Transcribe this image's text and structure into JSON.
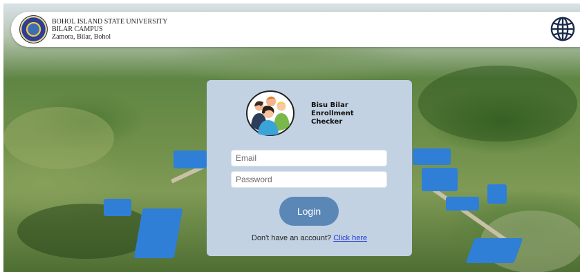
{
  "header": {
    "university_name": "BOHOL ISLAND STATE UNIVERSITY",
    "campus": "BILAR CAMPUS",
    "address": "Zamora, Bilar, Bohol",
    "seal_icon": "university-seal-icon",
    "language_icon": "globe-icon"
  },
  "login": {
    "app_title": "Bisu Bilar\nEnrollment\nChecker",
    "avatar_icon": "people-group-icon",
    "email_placeholder": "Email",
    "password_placeholder": "Password",
    "login_label": "Login",
    "signup_prompt": "Don't have an account?",
    "signup_link": "Click here"
  },
  "colors": {
    "card_bg": "#c2d2e3",
    "button_bg": "#5b87b7",
    "link": "#1a3ad6"
  }
}
